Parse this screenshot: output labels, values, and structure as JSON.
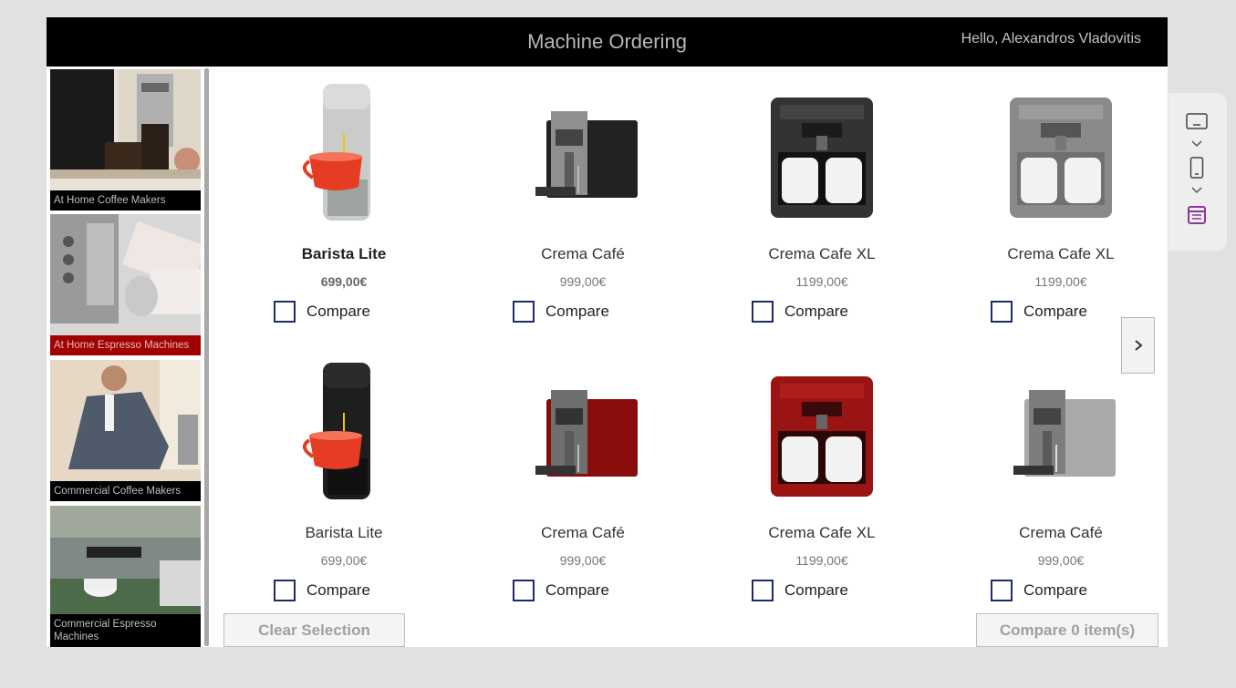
{
  "header": {
    "title": "Machine Ordering",
    "greeting": "Hello, Alexandros Vladovitis"
  },
  "sidebar": {
    "categories": [
      {
        "label": "At Home Coffee Makers",
        "selected": false
      },
      {
        "label": "At Home Espresso Machines",
        "selected": true
      },
      {
        "label": "Commercial Coffee Makers",
        "selected": false
      },
      {
        "label": "Commercial Espresso Machines",
        "selected": false
      }
    ]
  },
  "products": [
    {
      "name": "Barista Lite",
      "price": "699,00€",
      "compare_label": "Compare",
      "color": "#c9ccc9"
    },
    {
      "name": "Crema Café",
      "price": "999,00€",
      "compare_label": "Compare",
      "color": "#222222"
    },
    {
      "name": "Crema Cafe XL",
      "price": "1199,00€",
      "compare_label": "Compare",
      "color": "#333333"
    },
    {
      "name": "Crema Cafe XL",
      "price": "1199,00€",
      "compare_label": "Compare",
      "color": "#8a8a8a"
    },
    {
      "name": "Barista Lite",
      "price": "699,00€",
      "compare_label": "Compare",
      "color": "#1e1e1e"
    },
    {
      "name": "Crema Café",
      "price": "999,00€",
      "compare_label": "Compare",
      "color": "#8a0d0d"
    },
    {
      "name": "Crema Cafe XL",
      "price": "1199,00€",
      "compare_label": "Compare",
      "color": "#9a1414"
    },
    {
      "name": "Crema Café",
      "price": "999,00€",
      "compare_label": "Compare",
      "color": "#a9a9a9"
    }
  ],
  "buttons": {
    "clear": "Clear Selection",
    "compare": "Compare 0 item(s)"
  },
  "icons": {
    "next": "chevron-right-icon",
    "tablet": "tablet-layout-icon",
    "phone": "phone-layout-icon",
    "form": "form-layout-icon"
  },
  "colors": {
    "header_bg": "#000000",
    "selected_category": "#a10000",
    "checkbox_border": "#1f2a6b",
    "accent_purple": "#8a3b9a"
  }
}
